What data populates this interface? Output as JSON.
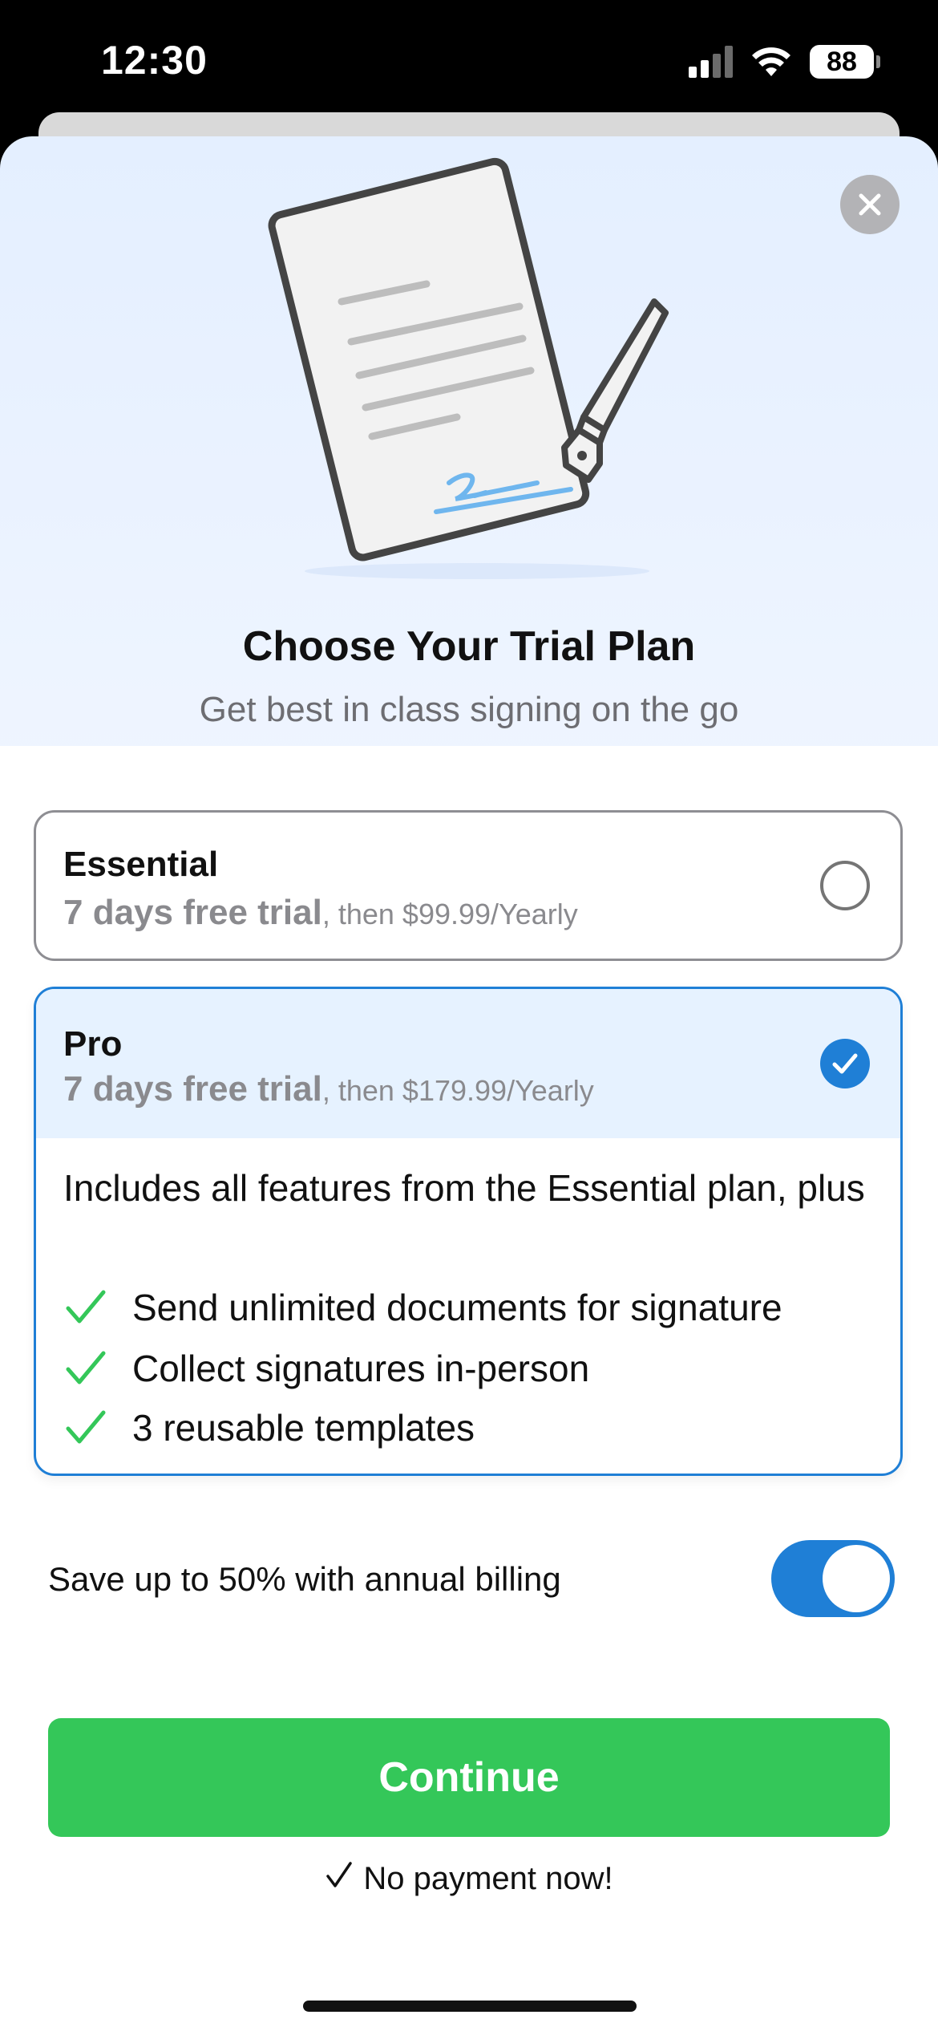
{
  "status_bar": {
    "time": "12:30",
    "battery": "88",
    "icons": [
      "signal-icon",
      "wifi-icon",
      "battery-icon"
    ]
  },
  "header": {
    "close_icon": "close-icon",
    "illustration": "document-signing-illustration",
    "title": "Choose Your Trial Plan",
    "subtitle": "Get best in class signing on the go"
  },
  "plans": {
    "essential": {
      "name": "Essential",
      "trial": "7 days free trial",
      "price": ", then $99.99/Yearly",
      "selected": false
    },
    "pro": {
      "name": "Pro",
      "trial": "7 days free trial",
      "price": ", then $179.99/Yearly",
      "selected": true,
      "includes": "Includes all features from the Essential plan, plus",
      "features": [
        "Send unlimited documents for signature",
        "Collect signatures in-person",
        "3 reusable templates"
      ]
    }
  },
  "billing": {
    "label": "Save up to 50% with annual billing",
    "toggle_on": true
  },
  "footer": {
    "continue_label": "Continue",
    "no_payment": "No payment now!"
  },
  "colors": {
    "accent_blue": "#1f7fd6",
    "continue_green": "#34c759",
    "check_green": "#34c759"
  }
}
